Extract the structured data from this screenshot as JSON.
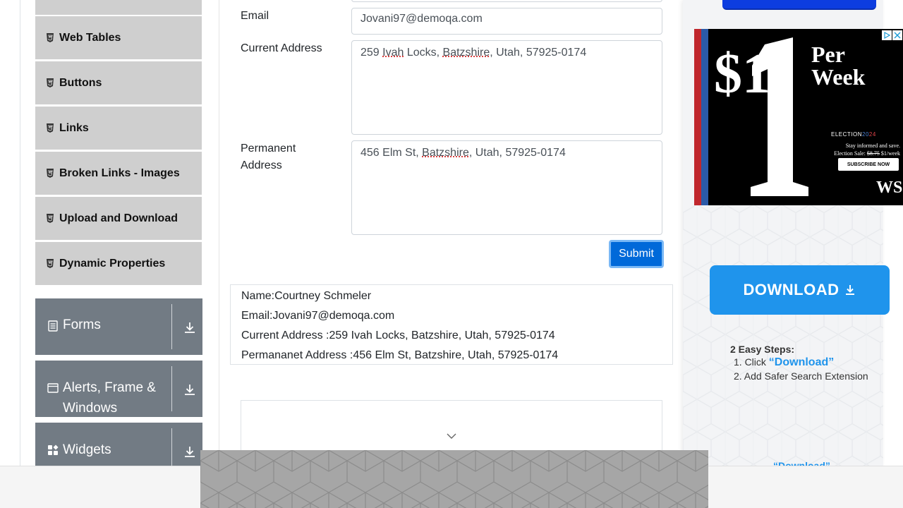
{
  "sidebar": {
    "elements_items": [
      {
        "label": ""
      },
      {
        "label": "Web Tables"
      },
      {
        "label": "Buttons"
      },
      {
        "label": "Links"
      },
      {
        "label": "Broken Links - Images"
      },
      {
        "label": "Upload and Download"
      },
      {
        "label": "Dynamic Properties"
      }
    ],
    "groups": [
      {
        "label": "Forms",
        "icon": "forms-icon"
      },
      {
        "label": "Alerts, Frame & Windows",
        "icon": "window-icon"
      },
      {
        "label": "Widgets",
        "icon": "widgets-icon"
      }
    ]
  },
  "form": {
    "email_label": "Email",
    "email_value": "Jovani97@demoqa.com",
    "current_label": "Current Address",
    "current_parts": [
      "259 ",
      "Ivah",
      " Locks, ",
      "Batzshire",
      ", Utah, 57925-0174"
    ],
    "permanent_label": "Permanent Address",
    "permanent_parts": [
      "456 Elm St, ",
      "Batzshire",
      ", Utah, 57925-0174"
    ],
    "submit_label": "Submit"
  },
  "output": {
    "name": "Name:Courtney Schmeler",
    "email": "Email:Jovani97@demoqa.com",
    "current": "Current Address :259 Ivah Locks, Batzshire, Utah, 57925-0174",
    "permanent": "Permananet Address :456 Elm St, Batzshire, Utah, 57925-0174"
  },
  "ads": {
    "wsj": {
      "price": "$1",
      "per_line1": "Per",
      "per_line2": "Week",
      "election_prefix": "ELECTION",
      "election_year_a": "20",
      "election_year_b": "24",
      "tagline1": "Stay informed and save.",
      "tagline2_prefix": "Election Sale: ",
      "tagline2_old_price": "$8.75",
      "tagline2_suffix": " $1/week",
      "subscribe": "SUBSCRIBE NOW",
      "logo": "WSJ"
    },
    "download_button": "DOWNLOAD",
    "steps_title": "2 Easy Steps:",
    "step1_prefix": "1. Click ",
    "step1_highlight": "“Download”",
    "step2": "2. Add Safer Search Extension",
    "bottom_peek": "“Download”"
  },
  "colors": {
    "submit": "#0069d9",
    "download": "#1f94ec",
    "sidebar_group": "#727b84",
    "sidebar_item": "#cfcfcf"
  }
}
